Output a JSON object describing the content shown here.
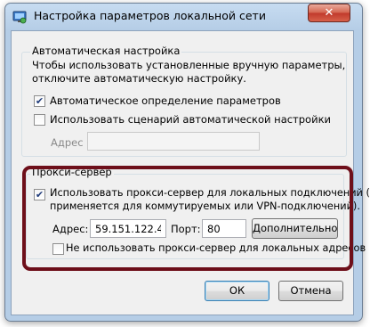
{
  "window": {
    "title": "Настройка параметров локальной сети",
    "close_label": "✕"
  },
  "auto_config": {
    "group_label": "Автоматическая настройка",
    "description_line1": "Чтобы использовать установленные вручную параметры,",
    "description_line2": "отключите автоматическую настройку.",
    "auto_detect": {
      "label": "Автоматическое определение параметров",
      "checked": true
    },
    "use_script": {
      "label": "Использовать сценарий автоматической настройки",
      "checked": false
    },
    "address_label": "Адрес",
    "address_value": ""
  },
  "proxy": {
    "group_label": "Прокси-сервер",
    "use_proxy": {
      "label_line1": "Использовать прокси-сервер для локальных подключений (не",
      "label_line2": "применяется для коммутируемых или VPN-подключений).",
      "checked": true
    },
    "address_label": "Адрес:",
    "address_value": "59.151.122.4",
    "port_label": "Порт:",
    "port_value": "80",
    "advanced_button": "Дополнительно",
    "bypass_local": {
      "label": "Не использовать прокси-сервер для локальных адресов",
      "checked": false
    }
  },
  "buttons": {
    "ok": "ОК",
    "cancel": "Отмена"
  },
  "colors": {
    "highlight_border": "#6e0f1a",
    "close_button": "#c0392b"
  }
}
